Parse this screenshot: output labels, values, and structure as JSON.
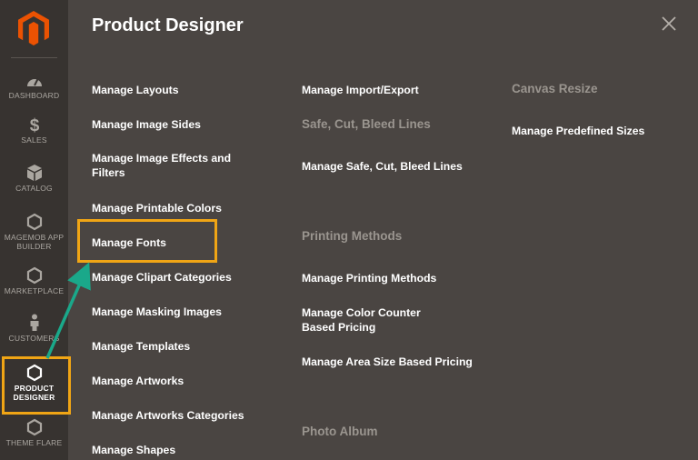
{
  "sidebar": {
    "items": [
      {
        "label": "DASHBOARD",
        "icon": "dashboard-icon"
      },
      {
        "label": "SALES",
        "icon": "dollar-icon"
      },
      {
        "label": "CATALOG",
        "icon": "box-icon"
      },
      {
        "label": "MAGEMOB APP BUILDER",
        "icon": "hexagon-icon"
      },
      {
        "label": "MARKETPLACE",
        "icon": "hexagon-icon"
      },
      {
        "label": "CUSTOMERS",
        "icon": "person-icon"
      },
      {
        "label": "PRODUCT DESIGNER",
        "icon": "hexagon-icon",
        "active": true
      },
      {
        "label": "THEME FLARE",
        "icon": "hexagon-icon"
      }
    ]
  },
  "panel": {
    "title": "Product Designer",
    "column1": [
      "Manage Layouts",
      "Manage Image Sides",
      "Manage Image Effects and Filters",
      "Manage Printable Colors",
      "Manage Fonts",
      "Manage Clipart Categories",
      "Manage Masking Images",
      "Manage Templates",
      "Manage Artworks",
      "Manage Artworks Categories",
      "Manage Shapes"
    ],
    "column2": {
      "import_export": "Manage Import/Export",
      "safe_heading": "Safe, Cut, Bleed Lines",
      "safe_link": "Manage Safe, Cut, Bleed Lines",
      "printing_heading": "Printing Methods",
      "printing_links": [
        "Manage Printing Methods",
        "Manage Color Counter Based Pricing",
        "Manage Area Size Based Pricing"
      ],
      "photo_heading": "Photo Album"
    },
    "column3": {
      "canvas_heading": "Canvas Resize",
      "canvas_link": "Manage Predefined Sizes"
    }
  },
  "colors": {
    "panel_bg": "#4a4542",
    "sidebar_bg": "#373330",
    "highlight": "#f0a515",
    "arrow": "#1aa88a",
    "logo": "#eb5202"
  }
}
